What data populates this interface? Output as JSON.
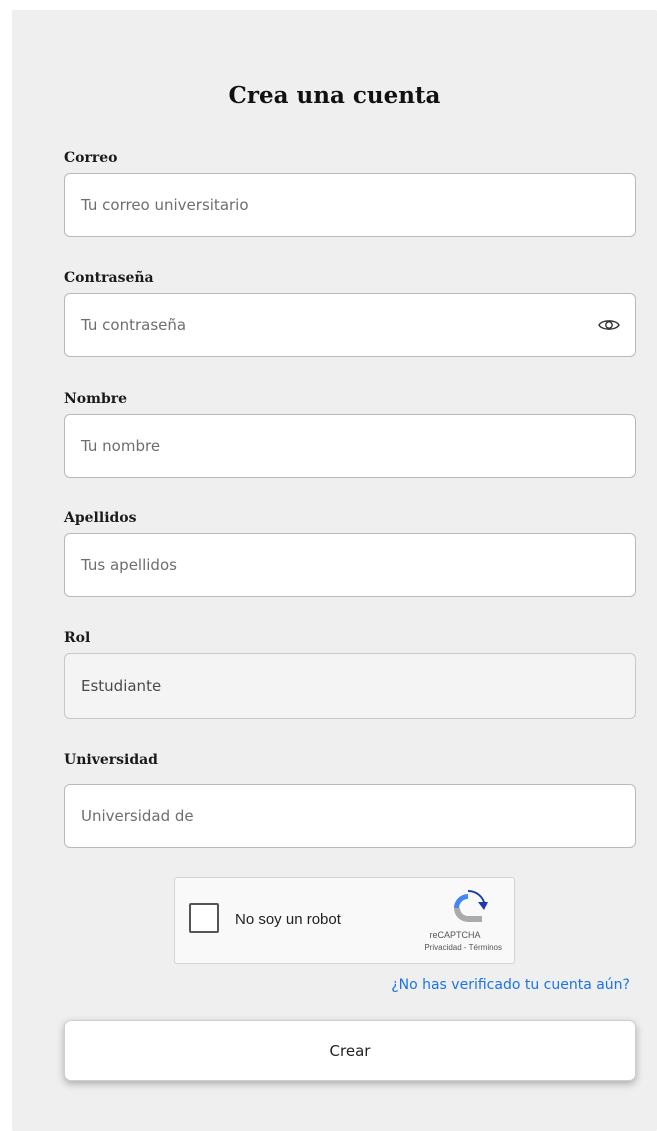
{
  "form": {
    "title": "Crea una cuenta",
    "fields": [
      {
        "label": "Correo",
        "placeholder": "Tu correo universitario"
      },
      {
        "label": "Contraseña",
        "placeholder": "Tu contraseña",
        "icon": "eye-icon"
      },
      {
        "label": "Nombre",
        "placeholder": "Tu nombre"
      },
      {
        "label": "Apellidos",
        "placeholder": "Tus apellidos"
      },
      {
        "label": "Rol",
        "value": "Estudiante"
      },
      {
        "label": "Universidad",
        "placeholder": "Universidad de"
      }
    ],
    "recaptcha": {
      "label": "No soy un robot",
      "brand": "reCAPTCHA",
      "links": "Privacidad - Términos",
      "checked": false
    },
    "verify_link": "¿No has verificado tu cuenta aún?",
    "submit_label": "Crear"
  },
  "colors": {
    "panel_bg": "#efefef",
    "link": "#1a73e8",
    "field_border": "#b9b9b9"
  }
}
